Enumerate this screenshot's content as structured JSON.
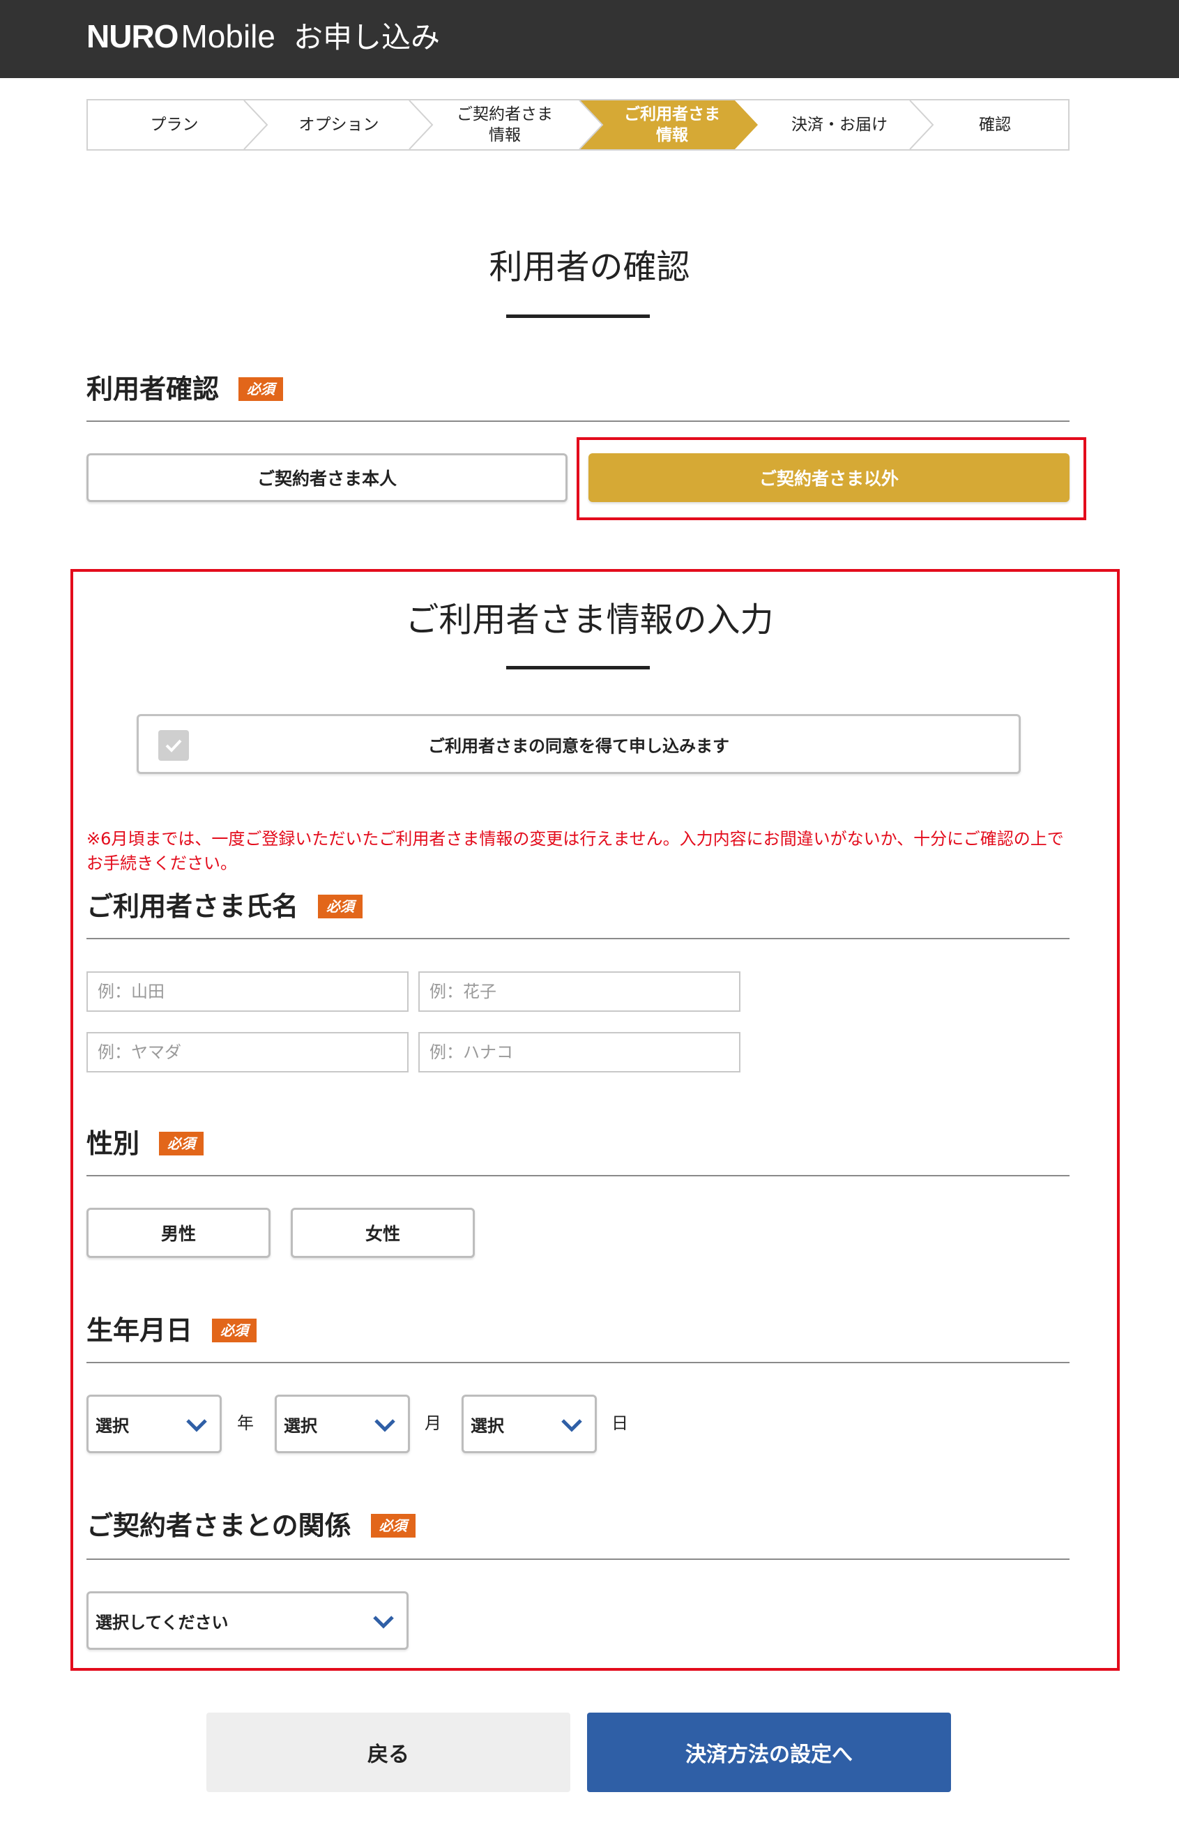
{
  "header": {
    "logo_nuro": "NURO",
    "logo_mobile": "Mobile",
    "apply": "お申し込み"
  },
  "steps": [
    {
      "label_line1": "プラン",
      "label_line2": "",
      "active": false
    },
    {
      "label_line1": "オプション",
      "label_line2": "",
      "active": false
    },
    {
      "label_line1": "ご契約者さま",
      "label_line2": "情報",
      "active": false
    },
    {
      "label_line1": "ご利用者さま",
      "label_line2": "情報",
      "active": true
    },
    {
      "label_line1": "決済・お届け",
      "label_line2": "",
      "active": false
    },
    {
      "label_line1": "確認",
      "label_line2": "",
      "active": false
    }
  ],
  "colors": {
    "accent_gold": "#d6a935",
    "required_badge": "#e2661a",
    "highlight_red": "#e30c1c",
    "primary_blue": "#2f5fa6",
    "header_bg": "#333333"
  },
  "page_title": "利用者の確認",
  "user_confirm": {
    "heading": "利用者確認",
    "required": "必須",
    "option_self": "ご契約者さま本人",
    "option_other": "ご契約者さま以外",
    "selected": "ご契約者さま以外"
  },
  "user_info": {
    "title": "ご利用者さま情報の入力",
    "consent_label": "ご利用者さまの同意を得て申し込みます",
    "consent_checked": true,
    "notice": "※6月頃までは、一度ご登録いただいたご利用者さま情報の変更は行えません。入力内容にお間違いがないか、十分にご確認の上でお手続きください。"
  },
  "name": {
    "heading": "ご利用者さま氏名",
    "required": "必須",
    "last_name_placeholder": "例：山田",
    "first_name_placeholder": "例：花子",
    "last_kana_placeholder": "例：ヤマダ",
    "first_kana_placeholder": "例：ハナコ"
  },
  "gender": {
    "heading": "性別",
    "required": "必須",
    "male": "男性",
    "female": "女性"
  },
  "birthdate": {
    "heading": "生年月日",
    "required": "必須",
    "year_value": "選択",
    "year_unit": "年",
    "month_value": "選択",
    "month_unit": "月",
    "day_value": "選択",
    "day_unit": "日"
  },
  "relation": {
    "heading": "ご契約者さまとの関係",
    "required": "必須",
    "value": "選択してください"
  },
  "footer": {
    "back": "戻る",
    "next": "決済方法の設定へ"
  },
  "icons": {
    "checkbox": "checkmark-icon",
    "select": "chevron-down-icon"
  }
}
